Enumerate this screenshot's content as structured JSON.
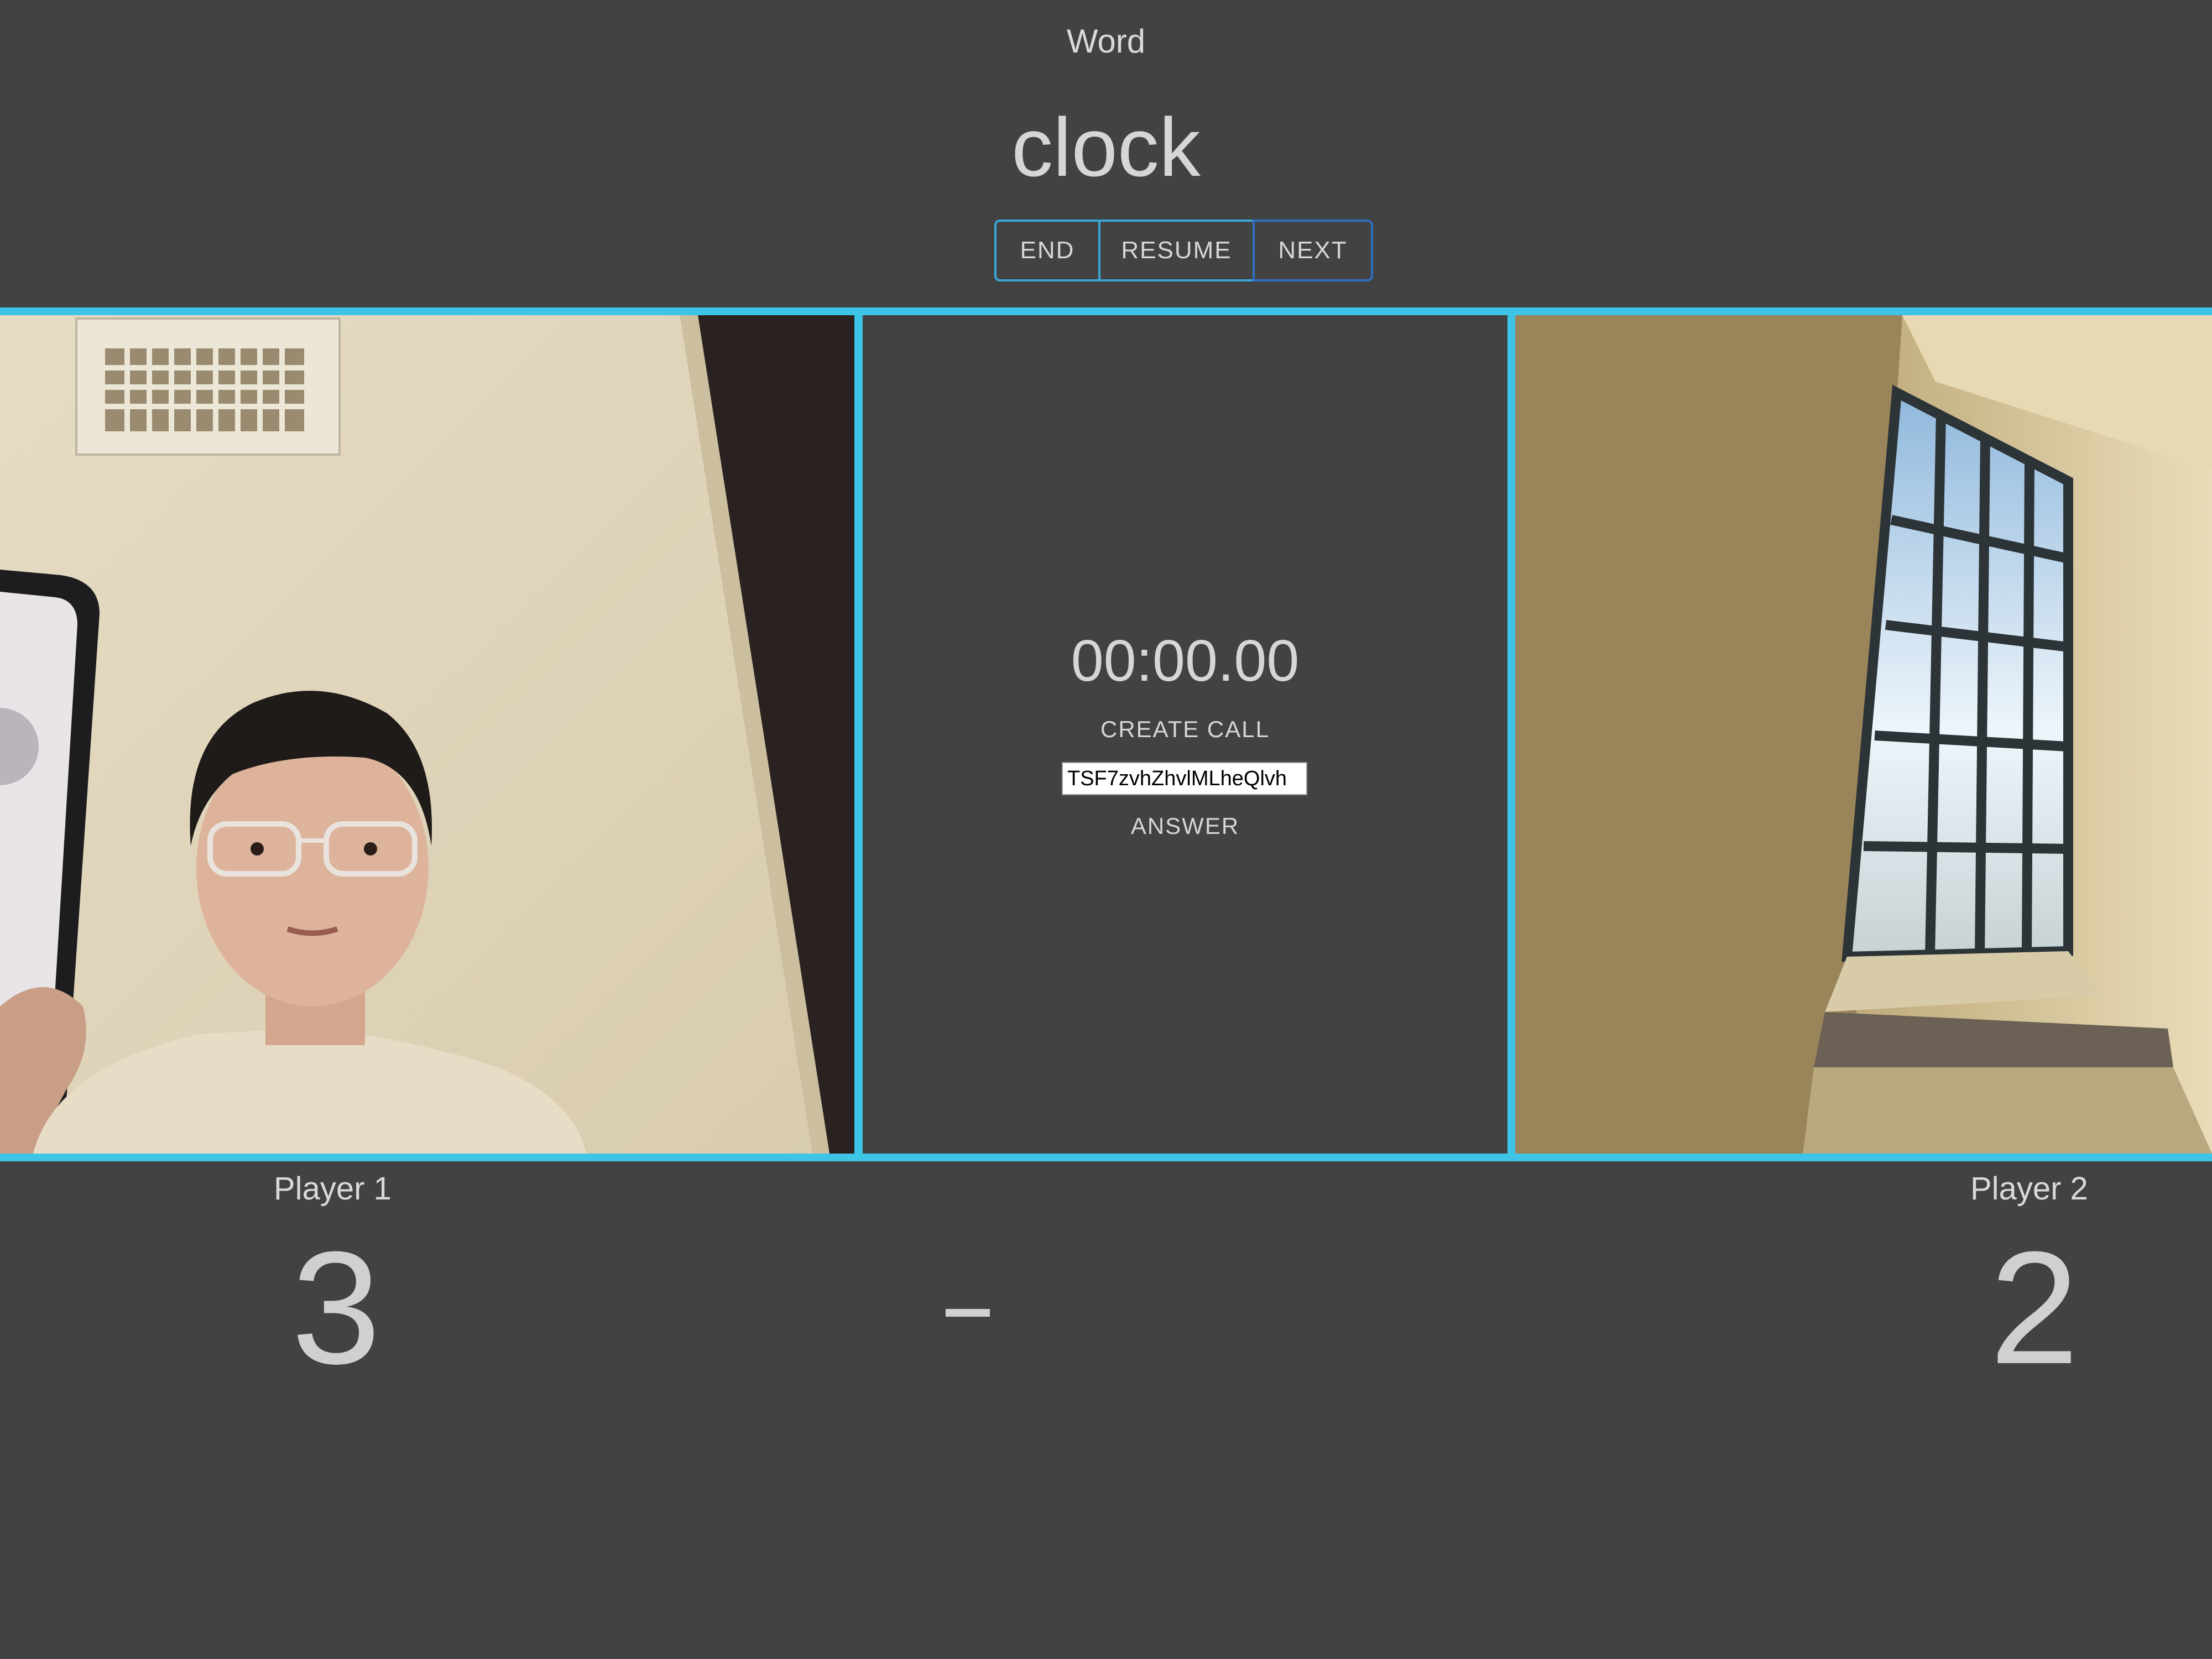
{
  "header": {
    "word_label": "Word",
    "word": "clock"
  },
  "controls": {
    "end_label": "END",
    "resume_label": "RESUME",
    "next_label": "NEXT"
  },
  "call": {
    "timer": "00:00.00",
    "create_call_label": "CREATE CALL",
    "call_id": "TSF7zvhZhvlMLheQlvh",
    "answer_label": "ANSWER"
  },
  "players": {
    "p1_label": "Player 1",
    "p1_score": "3",
    "p2_label": "Player 2",
    "p2_score": "2"
  },
  "colors": {
    "background": "#424242",
    "accent": "#3dc4e6"
  }
}
